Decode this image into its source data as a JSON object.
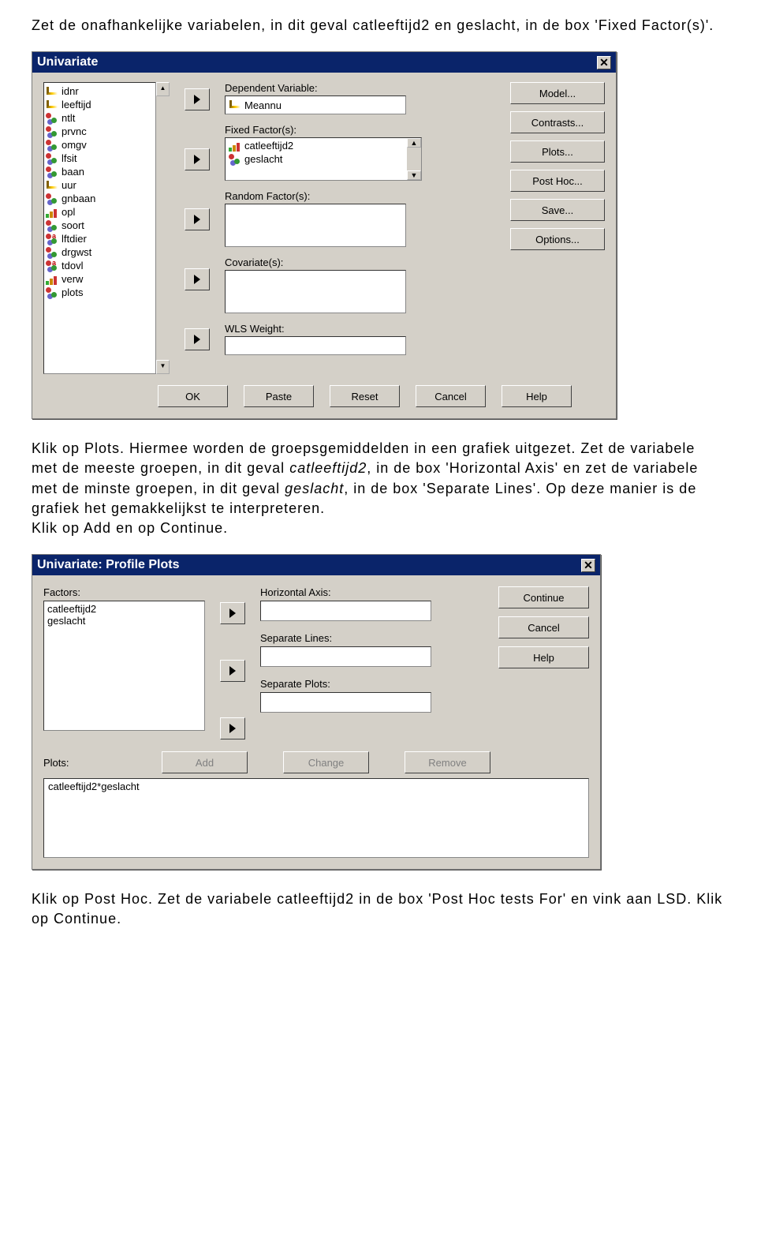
{
  "txt1": "Zet de onafhankelijke variabelen, in dit geval catleeftijd2 en geslacht, in de box 'Fixed Factor(s)'.",
  "txt2a": "Klik op Plots. Hiermee worden de groepsgemiddelden in een grafiek uitgezet. Zet de variabele met de meeste groepen, in dit geval ",
  "txt2b": ", in de box 'Horizontal Axis' en zet de variabele met de minste groepen, in dit geval ",
  "txt2c": ", in de box 'Separate Lines'. Op deze manier is de grafiek het gemakkelijkst te interpreteren.",
  "txt2d": "Klik op Add en op Continue.",
  "txt2_em1": "catleeftijd2",
  "txt2_em2": "geslacht",
  "txt3": "Klik op Post Hoc. Zet de variabele catleeftijd2 in de box 'Post Hoc tests For' en vink aan LSD. Klik op Continue.",
  "dlg1": {
    "title": "Univariate",
    "vars": [
      "idnr",
      "leeftijd",
      "ntlt",
      "prvnc",
      "omgv",
      "lfsit",
      "baan",
      "uur",
      "gnbaan",
      "opl",
      "soort",
      "lftdier",
      "drgwst",
      "tdovl",
      "verw",
      "plots"
    ],
    "var_types": [
      "scale",
      "scale",
      "nom",
      "nom",
      "nom",
      "nom",
      "nom",
      "scale",
      "nom",
      "ord",
      "nom",
      "anom",
      "nom",
      "anom",
      "ord",
      "nom"
    ],
    "dep_lbl": "Dependent Variable:",
    "dep_val": "Meannu",
    "ff_lbl": "Fixed Factor(s):",
    "ff1": "catleeftijd2",
    "ff2": "geslacht",
    "rf_lbl": "Random Factor(s):",
    "cov_lbl": "Covariate(s):",
    "wls_lbl": "WLS Weight:",
    "btn_model": "Model...",
    "btn_contrasts": "Contrasts...",
    "btn_plots": "Plots...",
    "btn_posthoc": "Post Hoc...",
    "btn_save": "Save...",
    "btn_options": "Options...",
    "b_ok": "OK",
    "b_paste": "Paste",
    "b_reset": "Reset",
    "b_cancel": "Cancel",
    "b_help": "Help"
  },
  "dlg2": {
    "title": "Univariate: Profile Plots",
    "factors_lbl": "Factors:",
    "fac1": "catleeftijd2",
    "fac2": "geslacht",
    "ha_lbl": "Horizontal Axis:",
    "sl_lbl": "Separate Lines:",
    "sp_lbl": "Separate Plots:",
    "btn_cont": "Continue",
    "btn_cancel": "Cancel",
    "btn_help": "Help",
    "plots_lbl": "Plots:",
    "b_add": "Add",
    "b_change": "Change",
    "b_remove": "Remove",
    "plot_entry": "catleeftijd2*geslacht"
  }
}
